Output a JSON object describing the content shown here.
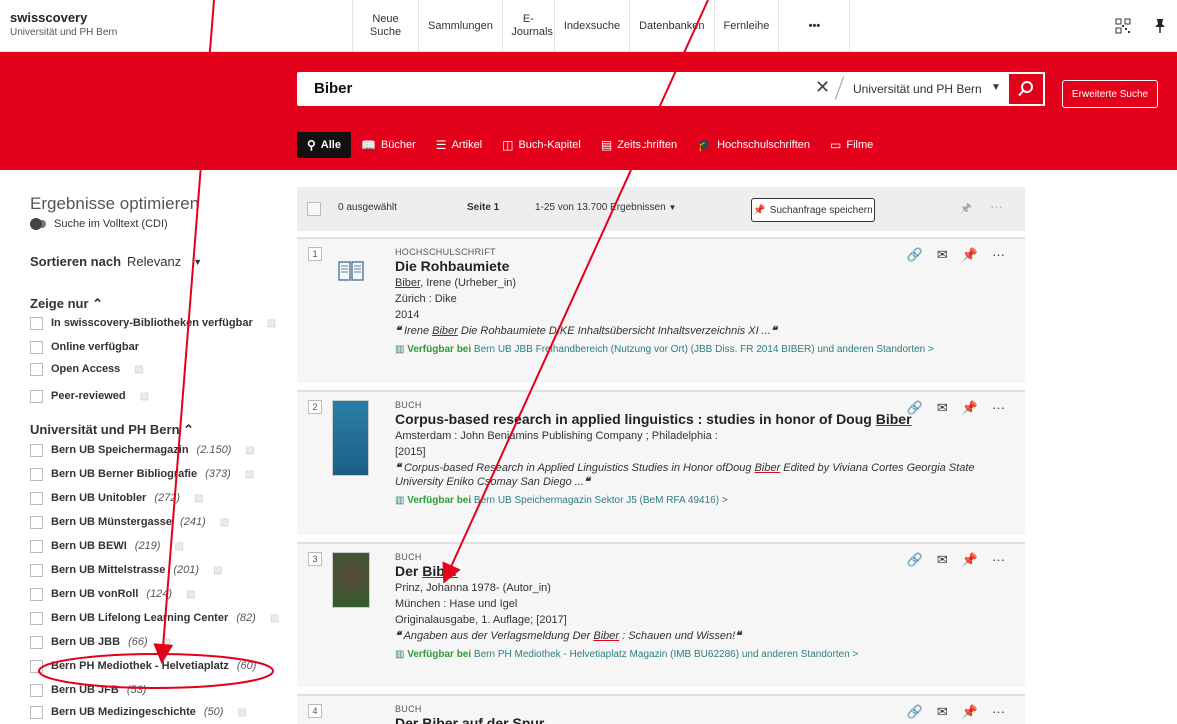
{
  "brand": {
    "name": "swisscovery",
    "sub": "Universität und PH Bern"
  },
  "nav": [
    "Neue Suche",
    "Sammlungen",
    "E-Journals",
    "Indexsuche",
    "Datenbanken",
    "Fernleihe",
    "•••"
  ],
  "search": {
    "query": "Biber",
    "scope": "Universität und PH Bern",
    "advanced": "Erweiterte Suche"
  },
  "tabs": [
    {
      "label": "Alle",
      "icon": "search-icon"
    },
    {
      "label": "Bücher",
      "icon": "book-icon"
    },
    {
      "label": "Artikel",
      "icon": "article-icon"
    },
    {
      "label": "Buch-Kapitel",
      "icon": "chapter-icon"
    },
    {
      "label": "Zeitschriften",
      "icon": "journal-icon"
    },
    {
      "label": "Hochschulschriften",
      "icon": "graduation-icon"
    },
    {
      "label": "Filme",
      "icon": "film-icon"
    }
  ],
  "sidebar": {
    "title": "Ergebnisse optimieren",
    "fulltext": "Suche im Volltext (CDI)",
    "sort_label": "Sortieren nach",
    "sort_value": "Relevanz",
    "show_only": "Zeige nur",
    "show_only_items": [
      "In swisscovery-Bibliotheken verfügbar",
      "Online verfügbar",
      "Open Access",
      "Peer-reviewed"
    ],
    "library_section": "Universität und PH Bern",
    "libraries": [
      {
        "name": "Bern UB Speichermagazin",
        "count": "(2.150)"
      },
      {
        "name": "Bern UB Berner Bibliografie",
        "count": "(373)"
      },
      {
        "name": "Bern UB Unitobler",
        "count": "(272)"
      },
      {
        "name": "Bern UB Münstergasse",
        "count": "(241)"
      },
      {
        "name": "Bern UB BEWI",
        "count": "(219)"
      },
      {
        "name": "Bern UB Mittelstrasse",
        "count": "(201)"
      },
      {
        "name": "Bern UB vonRoll",
        "count": "(124)"
      },
      {
        "name": "Bern UB Lifelong Learning Center",
        "count": "(82)"
      },
      {
        "name": "Bern UB JBB",
        "count": "(66)"
      },
      {
        "name": "Bern PH Mediothek - Helvetiaplatz",
        "count": "(60)"
      },
      {
        "name": "Bern UB JFB",
        "count": "(53)"
      },
      {
        "name": "Bern UB Medizingeschichte",
        "count": "(50)"
      }
    ]
  },
  "results_header": {
    "selected": "0 ausgewählt",
    "page": "Seite 1",
    "range": "1-25 von 13.700 Ergebnissen",
    "save": "Suchanfrage speichern"
  },
  "results": [
    {
      "num": "1",
      "type": "HOCHSCHULSCHRIFT",
      "title": "Die Rohbaumiete",
      "author_hl": "Biber",
      "author_rest": ", Irene (Urheber_in)",
      "pub": "Zürich : Dike",
      "year": "2014",
      "snip_pre": "Irene ",
      "snip_hl": "Biber",
      "snip_post": " Die Rohbaumiete DIKE Inhaltsübersicht Inhaltsverzeichnis XI ...",
      "avail_label": "Verfügbar bei",
      "avail_text": "Bern UB JBB  Freihandbereich (Nutzung vor Ort) (JBB Diss. FR 2014 BIBER) und anderen Standorten  >"
    },
    {
      "num": "2",
      "type": "BUCH",
      "title_pre": "Corpus-based research in applied linguistics : studies in honor of Doug ",
      "title_hl": "Biber",
      "pub": "Amsterdam : John Benjamins Publishing Company ; Philadelphia :",
      "year": "[2015]",
      "snip_pre": "Corpus-based Research in Applied Linguistics Studies in Honor ofDoug ",
      "snip_hl": "Biber",
      "snip_post": " Edited by Viviana Cortes Georgia State University Eniko Csomay San Diego ...",
      "avail_label": "Verfügbar bei",
      "avail_text": "Bern UB Speichermagazin  Sektor J5 (BeM RFA 49416)  >"
    },
    {
      "num": "3",
      "type": "BUCH",
      "title_pre": "Der ",
      "title_hl": "Biber",
      "author": "Prinz, Johanna 1978- (Autor_in)",
      "pub": "München : Hase und Igel",
      "edition": "Originalausgabe, 1. Auflage; [2017]",
      "snip_pre": "Angaben aus der Verlagsmeldung Der ",
      "snip_hl": "Biber",
      "snip_post": " : Schauen und Wissen!",
      "avail_label": "Verfügbar bei",
      "avail_text": "Bern PH Mediothek - Helvetiaplatz  Magazin (IMB BU62286) und anderen Standorten  >"
    },
    {
      "num": "4",
      "type": "BUCH",
      "title": "Der Biber auf der Spur"
    }
  ],
  "colors": {
    "brand_red": "#e2001a",
    "available_green": "#2e9b3a"
  }
}
